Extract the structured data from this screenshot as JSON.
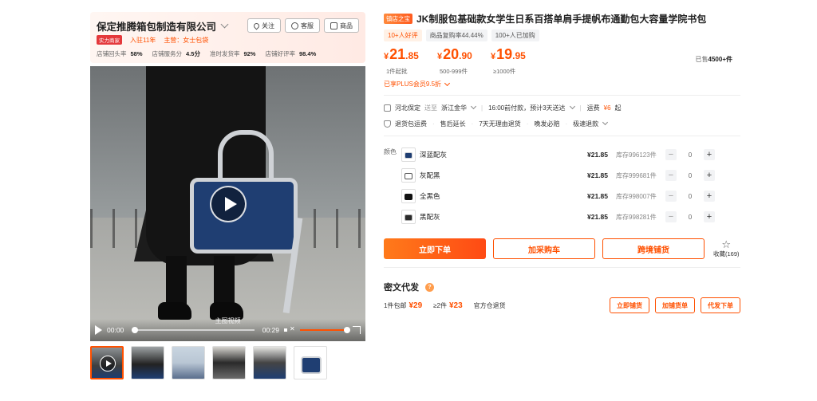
{
  "shop": {
    "name": "保定推腾箱包制造有限公司",
    "buttons": {
      "follow": "关注",
      "service": "客服",
      "products": "商品"
    },
    "badge": "实力商家",
    "joined": "入驻11年",
    "main_business": "主营：女士包袋",
    "stats": [
      {
        "label": "店铺回头率",
        "value": "58%"
      },
      {
        "label": "店铺服务分",
        "value": "4.5分"
      },
      {
        "label": "准时发货率",
        "value": "92%"
      },
      {
        "label": "店铺好评率",
        "value": "98.4%"
      }
    ]
  },
  "video": {
    "label": "主图视频",
    "current_time": "00:00",
    "duration": "00:29",
    "progress": 0,
    "volume": 1
  },
  "thumbnails": [
    "video",
    "image-2",
    "image-3",
    "image-4",
    "image-5",
    "image-6"
  ],
  "product": {
    "hot_badge": "镇店之宝",
    "title": "JK制服包基础款女学生日系百搭单肩手提帆布通勤包大容量学院书包",
    "pills": [
      "10+人好评",
      "商品复购率44.44%",
      "100+人已加购"
    ],
    "prices": [
      {
        "currency": "¥",
        "int": "21",
        "dec": ".85",
        "sub": "1件起批"
      },
      {
        "currency": "¥",
        "int": "20",
        "dec": ".90",
        "sub": "500-999件"
      },
      {
        "currency": "¥",
        "int": "19",
        "dec": ".95",
        "sub": "≥1000件"
      }
    ],
    "sold_prefix": "已售",
    "sold_value": "4500+件",
    "plus_text": "已享PLUS会员9.5折",
    "shipping": {
      "from": "河北保定",
      "to_word": "送至",
      "to": "浙江金华",
      "eta": "16:00前付款，预计3天送达",
      "fee_label": "运费",
      "fee": "¥6",
      "fee_suffix": "起"
    },
    "guarantees": [
      "退货包运费",
      "售后延长",
      "7天无理由退货",
      "晚发必赔",
      "极速退款"
    ]
  },
  "sku": {
    "label": "颜色",
    "items": [
      {
        "name": "深蓝配灰",
        "price": "¥21.85",
        "stock": "库存996123件",
        "qty": "0",
        "color": "#1f3e72"
      },
      {
        "name": "灰配黑",
        "price": "¥21.85",
        "stock": "库存999681件",
        "qty": "0",
        "color": "#8d9094"
      },
      {
        "name": "全黑色",
        "price": "¥21.85",
        "stock": "库存998007件",
        "qty": "0",
        "color": "#111111"
      },
      {
        "name": "黑配灰",
        "price": "¥21.85",
        "stock": "库存998281件",
        "qty": "0",
        "color": "#2a2a2a"
      }
    ],
    "minus": "−",
    "plus": "+"
  },
  "actions": {
    "buy": "立即下单",
    "cart": "加采购车",
    "cross": "跨境铺货",
    "fav_label": "收藏",
    "fav_count": "(169)"
  },
  "miwen": {
    "title": "密文代发",
    "row": {
      "one": "1件包邮",
      "one_price": "¥29",
      "two": "≥2件",
      "two_price": "¥23",
      "note": "官方仓退货"
    },
    "buttons": [
      "立即铺货",
      "加铺货单",
      "代发下单"
    ]
  },
  "colors": {
    "accent": "#ff5000",
    "shop_bg": "#fff6f2"
  }
}
